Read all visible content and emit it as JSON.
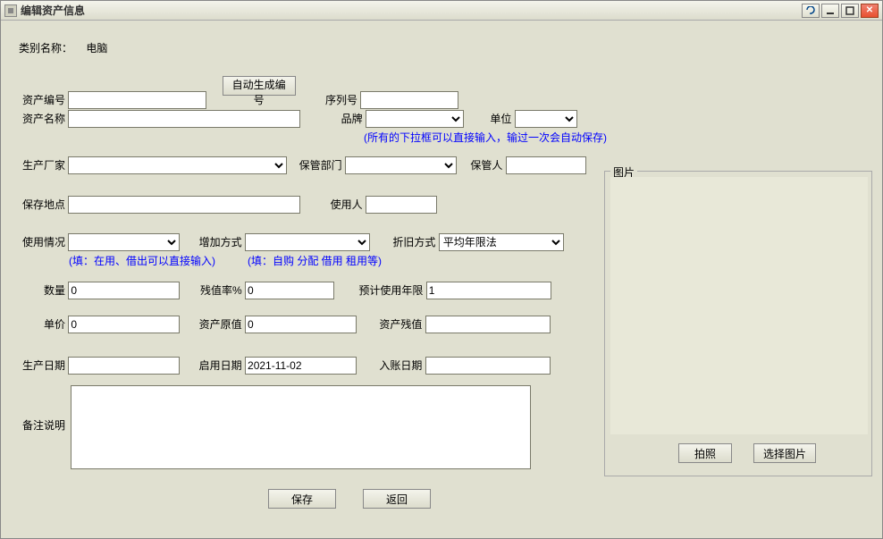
{
  "window": {
    "title": "编辑资产信息"
  },
  "category": {
    "label": "类别名称：",
    "value": "电脑"
  },
  "fields": {
    "asset_no": {
      "label": "资产编号",
      "value": ""
    },
    "autogen": {
      "label": "自动生成编号"
    },
    "serial": {
      "label": "序列号",
      "value": ""
    },
    "asset_name": {
      "label": "资产名称",
      "value": ""
    },
    "brand": {
      "label": "品牌",
      "value": ""
    },
    "unit": {
      "label": "单位",
      "value": ""
    },
    "hint_dropdown": "(所有的下拉框可以直接输入，输过一次会自动保存)",
    "manufacturer": {
      "label": "生产厂家",
      "value": ""
    },
    "custody_dept": {
      "label": "保管部门",
      "value": ""
    },
    "custodian": {
      "label": "保管人",
      "value": ""
    },
    "location": {
      "label": "保存地点",
      "value": ""
    },
    "user": {
      "label": "使用人",
      "value": ""
    },
    "use_status": {
      "label": "使用情况",
      "value": ""
    },
    "add_method": {
      "label": "增加方式",
      "value": ""
    },
    "depr_method": {
      "label": "折旧方式",
      "value": "平均年限法"
    },
    "hint_use": "(填：在用、借出可以直接输入)",
    "hint_add": "(填：自购 分配 借用 租用等)",
    "quantity": {
      "label": "数量",
      "value": "0"
    },
    "salvage_rate": {
      "label": "残值率%",
      "value": "0"
    },
    "expected_life": {
      "label": "预计使用年限",
      "value": "1"
    },
    "unit_price": {
      "label": "单价",
      "value": "0"
    },
    "orig_value": {
      "label": "资产原值",
      "value": "0"
    },
    "salvage_value": {
      "label": "资产残值",
      "value": ""
    },
    "prod_date": {
      "label": "生产日期",
      "value": ""
    },
    "start_date": {
      "label": "启用日期",
      "value": "2021-11-02"
    },
    "entry_date": {
      "label": "入账日期",
      "value": ""
    },
    "remark": {
      "label": "备注说明",
      "value": ""
    }
  },
  "image_panel": {
    "label": "图片",
    "take_photo": "拍照",
    "choose_image": "选择图片"
  },
  "actions": {
    "save": "保存",
    "back": "返回"
  }
}
